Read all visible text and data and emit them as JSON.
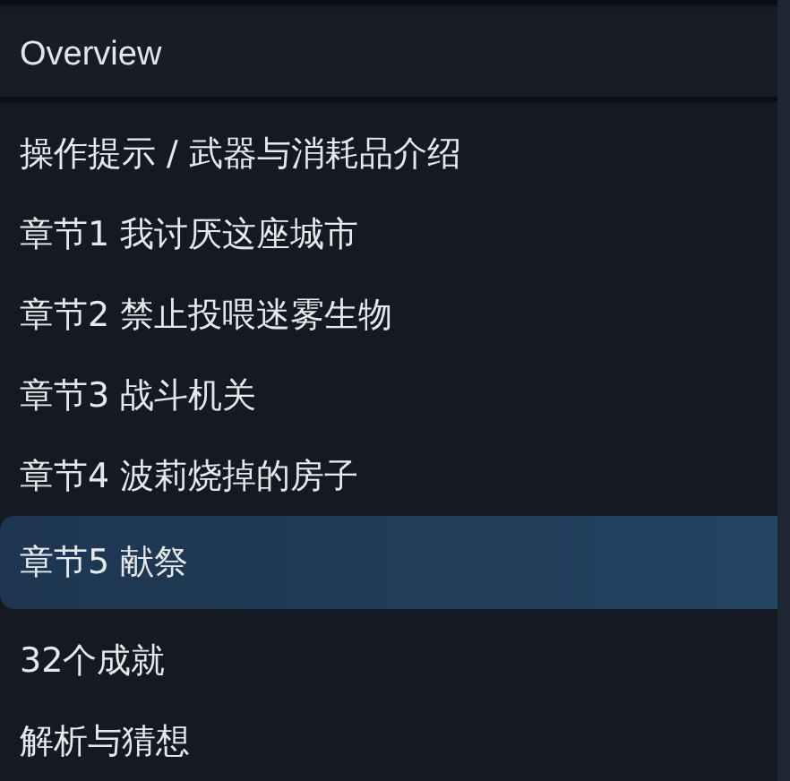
{
  "header": {
    "title": "Overview"
  },
  "items": [
    {
      "label": "操作提示 / 武器与消耗品介绍",
      "selected": false
    },
    {
      "label": "章节1 我讨厌这座城市",
      "selected": false
    },
    {
      "label": "章节2 禁止投喂迷雾生物",
      "selected": false
    },
    {
      "label": "章节3 战斗机关",
      "selected": false
    },
    {
      "label": "章节4 波莉烧掉的房子",
      "selected": false
    },
    {
      "label": "章节5 献祭",
      "selected": true
    },
    {
      "label": "32个成就",
      "selected": false
    },
    {
      "label": "解析与猜想",
      "selected": false
    }
  ]
}
